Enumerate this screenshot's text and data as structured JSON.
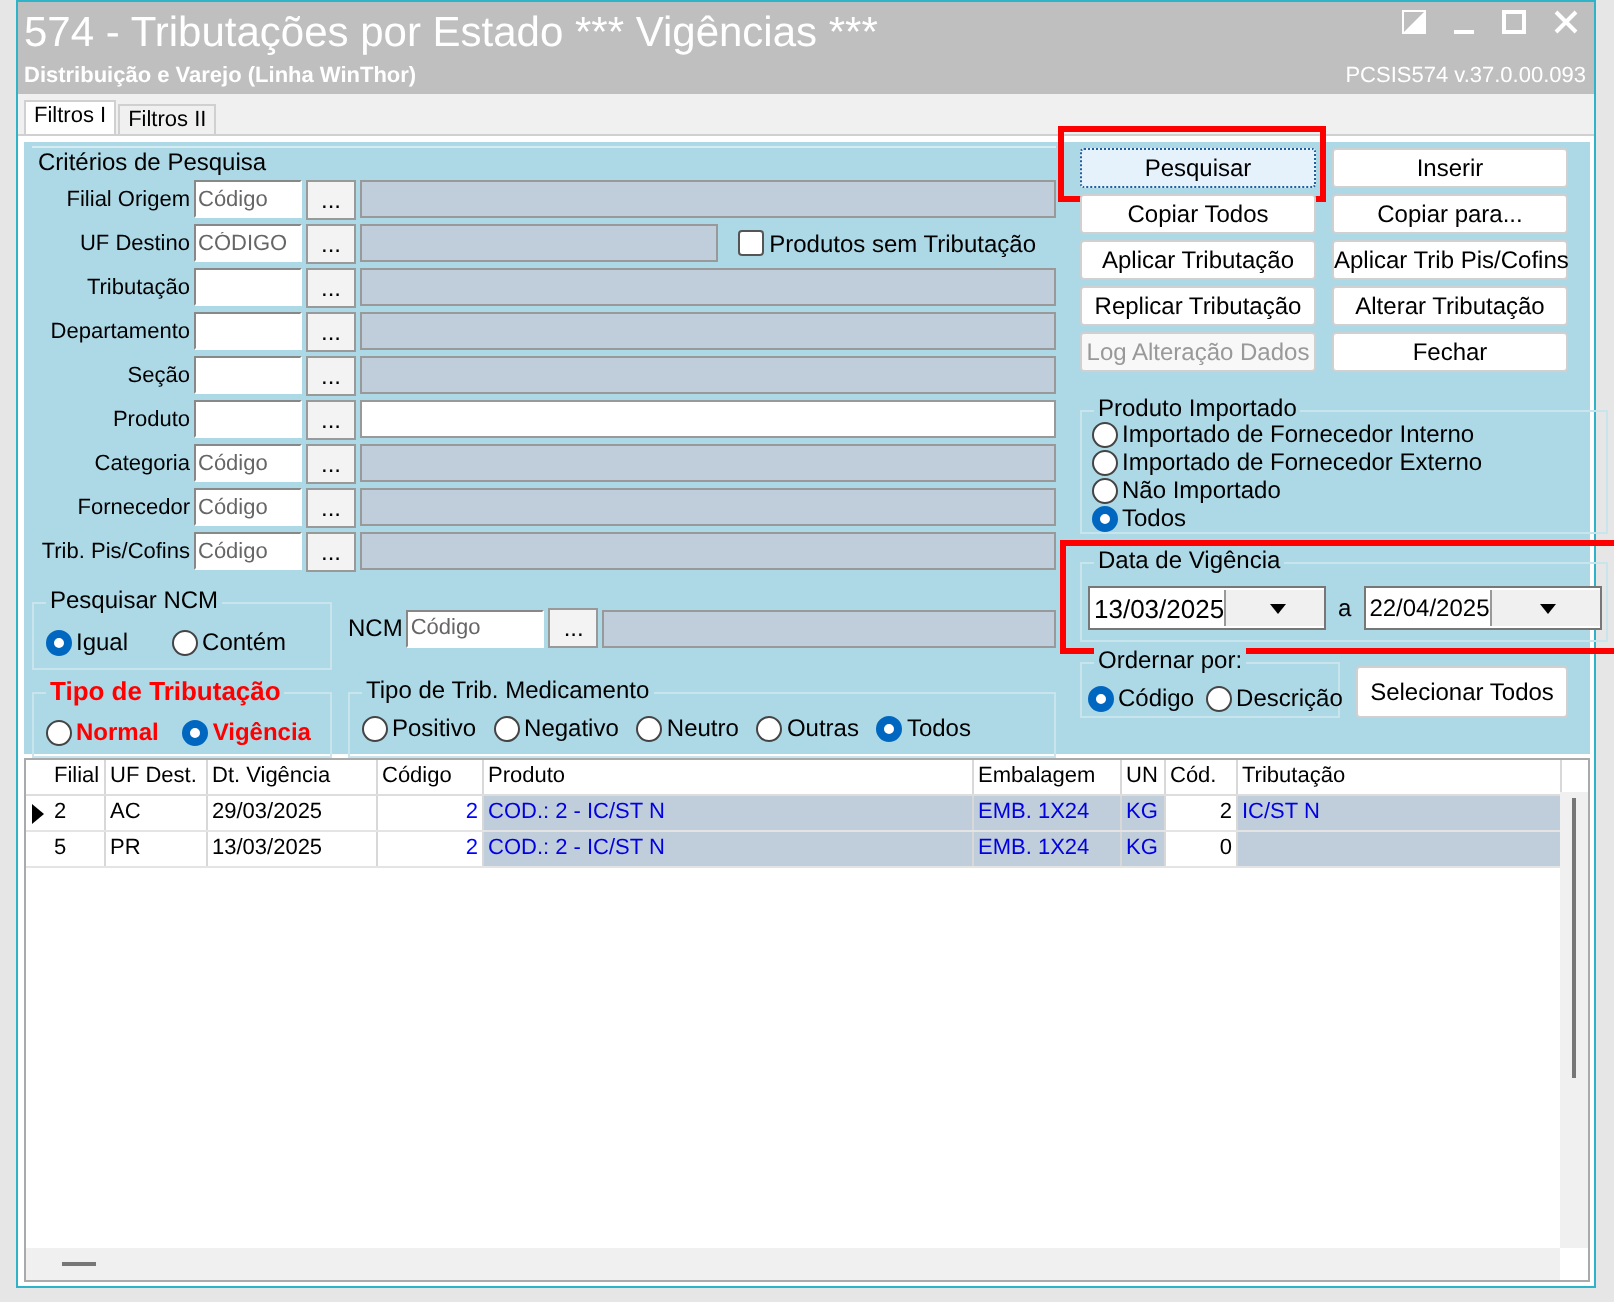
{
  "window": {
    "title": "574 - Tributações por Estado *** Vigências ***",
    "subtitle": "Distribuição e Varejo (Linha WinThor)",
    "version": "PCSIS574  v.37.0.00.093"
  },
  "tabs": [
    {
      "label": "Filtros I",
      "selected": true
    },
    {
      "label": "Filtros II",
      "selected": false
    }
  ],
  "criteria": {
    "title": "Critérios de Pesquisa",
    "fields": [
      {
        "label": "Filial Origem",
        "placeholder": "Código",
        "lookup": "...",
        "description_enabled": false
      },
      {
        "label": "UF Destino",
        "placeholder": "CÓDIGO",
        "lookup": "...",
        "description_enabled": false,
        "checkbox": {
          "label": "Produtos sem Tributação",
          "checked": false
        }
      },
      {
        "label": "Tributação",
        "lookup": "...",
        "description_enabled": false
      },
      {
        "label": "Departamento",
        "lookup": "...",
        "description_enabled": false
      },
      {
        "label": "Seção",
        "lookup": "...",
        "description_enabled": false
      },
      {
        "label": "Produto",
        "lookup": "...",
        "description_enabled": true
      },
      {
        "label": "Categoria",
        "placeholder": "Código",
        "lookup": "...",
        "description_enabled": false
      },
      {
        "label": "Fornecedor",
        "placeholder": "Código",
        "lookup": "...",
        "description_enabled": false
      },
      {
        "label": "Trib. Pis/Cofins",
        "placeholder": "Código",
        "lookup": "...",
        "description_enabled": false
      }
    ]
  },
  "ncm_search": {
    "title": "Pesquisar NCM",
    "options": [
      {
        "label": "Igual",
        "selected": true
      },
      {
        "label": "Contém",
        "selected": false
      }
    ]
  },
  "ncm": {
    "label": "NCM",
    "placeholder": "Código",
    "lookup": "..."
  },
  "tax_type": {
    "title": "Tipo de Tributação",
    "options": [
      {
        "label": "Normal",
        "selected": false
      },
      {
        "label": "Vigência",
        "selected": true
      }
    ]
  },
  "medication_type": {
    "title": "Tipo de Trib. Medicamento",
    "options": [
      {
        "label": "Positivo",
        "selected": false
      },
      {
        "label": "Negativo",
        "selected": false
      },
      {
        "label": "Neutro",
        "selected": false
      },
      {
        "label": "Outras",
        "selected": false
      },
      {
        "label": "Todos",
        "selected": true
      }
    ]
  },
  "buttons": [
    {
      "label": "Pesquisar",
      "disabled": false,
      "highlighted": true
    },
    {
      "label": "Inserir",
      "disabled": false,
      "highlighted": false
    },
    {
      "label": "Copiar Todos",
      "disabled": false,
      "highlighted": false
    },
    {
      "label": "Copiar para...",
      "disabled": false,
      "highlighted": false
    },
    {
      "label": "Aplicar Tributação",
      "disabled": false,
      "highlighted": false
    },
    {
      "label": "Aplicar Trib Pis/Cofins",
      "disabled": false,
      "highlighted": false
    },
    {
      "label": "Replicar Tributação",
      "disabled": false,
      "highlighted": false
    },
    {
      "label": "Alterar Tributação",
      "disabled": false,
      "highlighted": false
    },
    {
      "label": "Log Alteração Dados",
      "disabled": true,
      "highlighted": false
    },
    {
      "label": "Fechar",
      "disabled": false,
      "highlighted": false
    }
  ],
  "imported": {
    "title": "Produto Importado",
    "options": [
      {
        "label": "Importado de Fornecedor Interno",
        "selected": false
      },
      {
        "label": "Importado de Fornecedor Externo",
        "selected": false
      },
      {
        "label": "Não Importado",
        "selected": false
      },
      {
        "label": "Todos",
        "selected": true
      }
    ]
  },
  "validity": {
    "title": "Data de Vigência",
    "from": "13/03/2025",
    "separator": "a",
    "to": "22/04/2025",
    "highlighted": true
  },
  "order_by": {
    "title": "Ordernar por:",
    "options": [
      {
        "label": "Código",
        "selected": true
      },
      {
        "label": "Descrição",
        "selected": false
      }
    ]
  },
  "select_all": "Selecionar Todos",
  "table": {
    "columns": [
      {
        "label": "Filial",
        "kind": "text"
      },
      {
        "label": "UF Dest.",
        "kind": "text"
      },
      {
        "label": "Dt. Vigência",
        "kind": "text"
      },
      {
        "label": "Código",
        "kind": "code"
      },
      {
        "label": "Produto",
        "kind": "lookup"
      },
      {
        "label": "Embalagem",
        "kind": "lookup"
      },
      {
        "label": "UN",
        "kind": "lookup"
      },
      {
        "label": "Cód.",
        "kind": "number"
      },
      {
        "label": "Tributação",
        "kind": "lookup"
      }
    ],
    "rows": [
      {
        "current": true,
        "cells": [
          "2",
          "AC",
          "29/03/2025",
          "2",
          "COD.: 2 - IC/ST N",
          "EMB. 1X24",
          "KG",
          "2",
          "IC/ST N"
        ]
      },
      {
        "current": false,
        "cells": [
          "5",
          "PR",
          "13/03/2025",
          "2",
          "COD.: 2 - IC/ST N",
          "EMB. 1X24",
          "KG",
          "0",
          ""
        ]
      }
    ]
  }
}
